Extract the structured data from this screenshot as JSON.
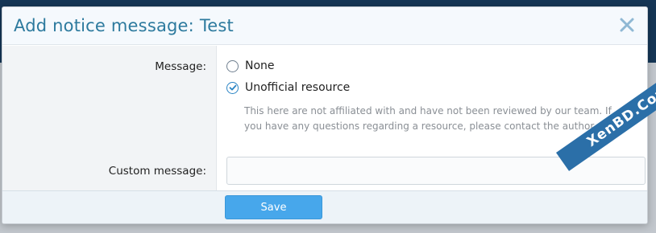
{
  "dialog": {
    "title": "Add notice message: Test",
    "close_icon": "close-icon"
  },
  "form": {
    "message_label": "Message:",
    "options": [
      {
        "label": "None",
        "selected": false
      },
      {
        "label": "Unofficial resource",
        "selected": true
      }
    ],
    "option_hint": "This here are not affiliated with and have not been reviewed by our team. If you have any questions regarding a resource, please contact the author.",
    "custom_message_label": "Custom message:",
    "custom_message_value": ""
  },
  "footer": {
    "save_label": "Save"
  },
  "watermark": {
    "text": "XenBD.Com"
  },
  "colors": {
    "accent": "#47a7eb",
    "title": "#2d7a9e",
    "radio_checked": "#2a84c4"
  }
}
